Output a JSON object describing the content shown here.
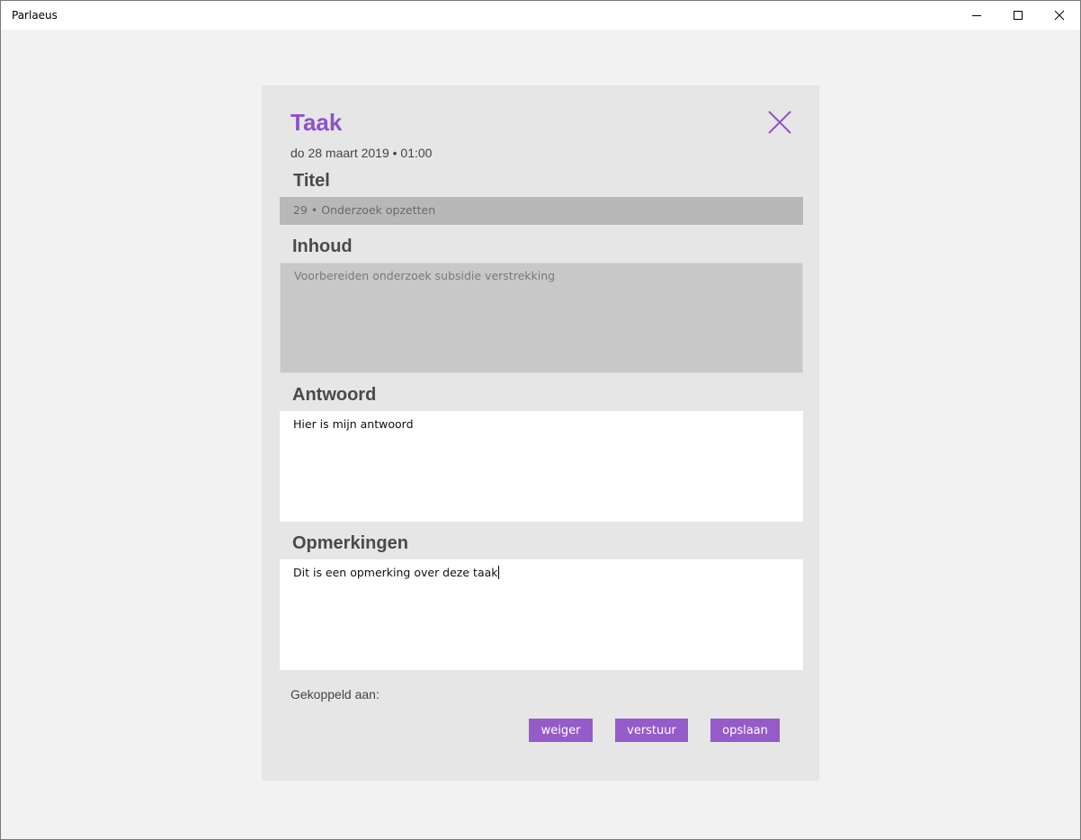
{
  "window": {
    "title": "Parlaeus"
  },
  "dialog": {
    "title": "Taak",
    "date": "do 28 maart 2019 • 01:00",
    "accent_color": "#8e52c8",
    "fields": {
      "titel": {
        "label": "Titel",
        "value": "29 • Onderzoek opzetten"
      },
      "inhoud": {
        "label": "Inhoud",
        "value": "Voorbereiden onderzoek subsidie verstrekking"
      },
      "antwoord": {
        "label": "Antwoord",
        "value": "Hier is mijn antwoord"
      },
      "opmerkingen": {
        "label": "Opmerkingen",
        "value": "Dit is een opmerking over deze taak"
      }
    },
    "gekoppeld_label": "Gekoppeld aan:",
    "buttons": {
      "weiger": "weiger",
      "verstuur": "verstuur",
      "opslaan": "opslaan"
    }
  },
  "icons": {
    "close": "close-icon",
    "minimize": "minimize-icon",
    "maximize": "maximize-icon",
    "window_close": "window-close-icon"
  }
}
